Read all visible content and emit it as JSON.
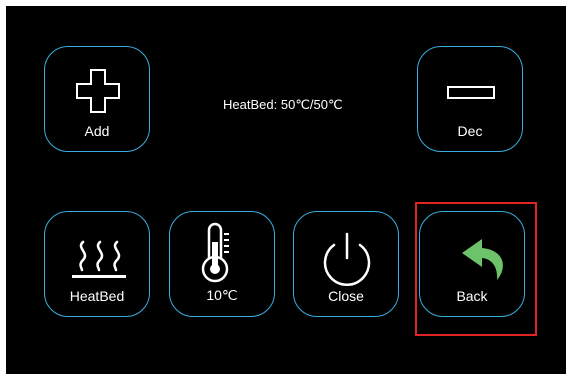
{
  "status": {
    "label": "HeatBed",
    "separator": ":",
    "current": "50",
    "target": "50",
    "unit": "℃"
  },
  "buttons": {
    "add": {
      "label": "Add",
      "icon": "plus-icon"
    },
    "dec": {
      "label": "Dec",
      "icon": "minus-icon"
    },
    "heatbed": {
      "label": "HeatBed",
      "icon": "heat-waves-icon"
    },
    "step": {
      "label": "10℃",
      "icon": "thermometer-icon"
    },
    "close": {
      "label": "Close",
      "icon": "power-icon"
    },
    "back": {
      "label": "Back",
      "icon": "back-arrow-icon"
    }
  },
  "colors": {
    "background": "#000000",
    "button_border": "#3aaee0",
    "text": "#ffffff",
    "back_arrow": "#6cc36a",
    "selection_frame": "#e02424"
  },
  "selected_button": "back"
}
